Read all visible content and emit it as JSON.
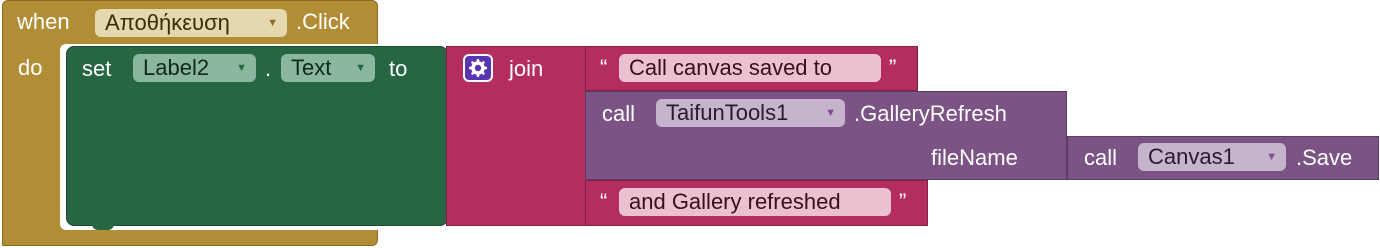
{
  "event_block": {
    "when_label": "when",
    "component": "Αποθήκευση",
    "event": ".Click",
    "do_label": "do"
  },
  "set_block": {
    "set_label": "set",
    "component": "Label2",
    "dot": ".",
    "property": "Text",
    "to_label": "to"
  },
  "join_block": {
    "icon": "gear-icon",
    "label": "join",
    "open_quote": "“",
    "close_quote": "”"
  },
  "text_1": "Call canvas saved to",
  "gallery_call": {
    "call_label": "call",
    "component": "TaifunTools1",
    "method": ".GalleryRefresh",
    "param_label": "fileName"
  },
  "save_call": {
    "call_label": "call",
    "component": "Canvas1",
    "method": ".Save"
  },
  "text_2": "and Gallery refreshed",
  "colors": {
    "event": "#b18e35",
    "setter": "#266643",
    "text_join": "#b32d5e",
    "procedure": "#7c5385",
    "mutator": "#5a33b0"
  },
  "dropdown_arrow": "▼"
}
